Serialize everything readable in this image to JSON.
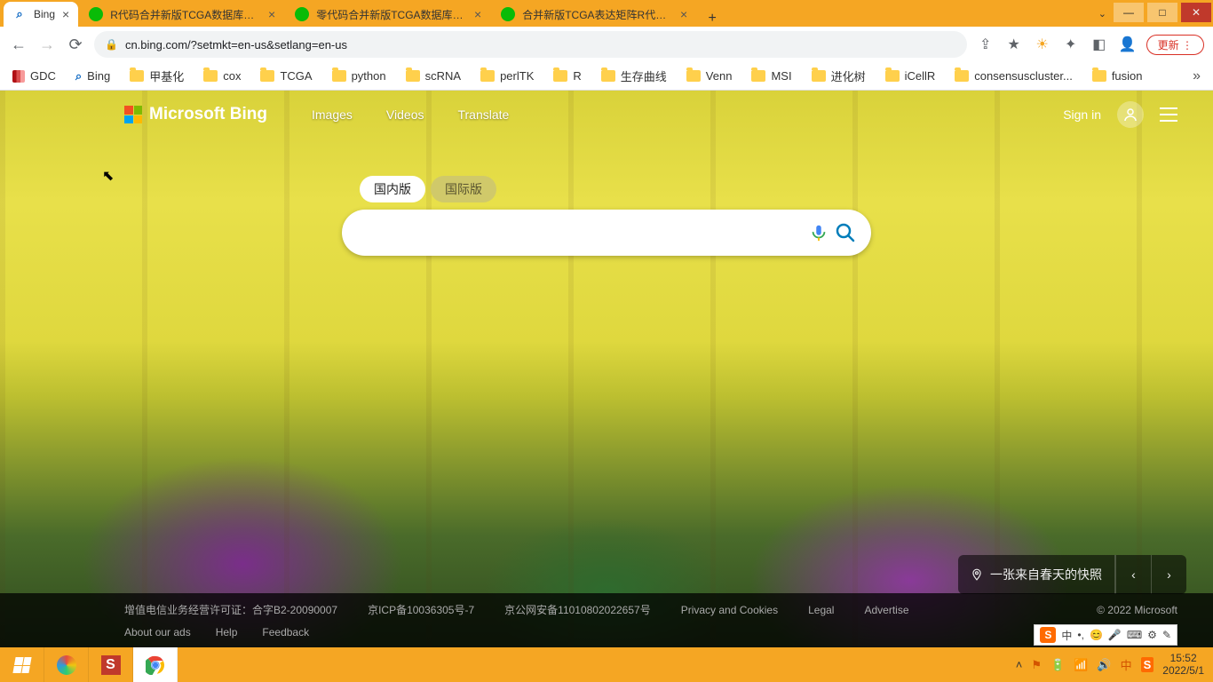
{
  "window": {
    "tabs": [
      {
        "title": "Bing",
        "favicon": "bing"
      },
      {
        "title": "R代码合并新版TCGA数据库RNA",
        "favicon": "wechat"
      },
      {
        "title": "零代码合并新版TCGA数据库RNA",
        "favicon": "wechat"
      },
      {
        "title": "合并新版TCGA表达矩阵R代码系",
        "favicon": "wechat"
      }
    ]
  },
  "toolbar": {
    "url": "cn.bing.com/?setmkt=en-us&setlang=en-us",
    "update_label": "更新"
  },
  "bookmarks": [
    {
      "label": "GDC",
      "icon": "gdc"
    },
    {
      "label": "Bing",
      "icon": "bing"
    },
    {
      "label": "甲基化",
      "icon": "folder"
    },
    {
      "label": "cox",
      "icon": "folder"
    },
    {
      "label": "TCGA",
      "icon": "folder"
    },
    {
      "label": "python",
      "icon": "folder"
    },
    {
      "label": "scRNA",
      "icon": "folder"
    },
    {
      "label": "perlTK",
      "icon": "folder"
    },
    {
      "label": "R",
      "icon": "folder"
    },
    {
      "label": "生存曲线",
      "icon": "folder"
    },
    {
      "label": "Venn",
      "icon": "folder"
    },
    {
      "label": "MSI",
      "icon": "folder"
    },
    {
      "label": "进化树",
      "icon": "folder"
    },
    {
      "label": "iCellR",
      "icon": "folder"
    },
    {
      "label": "consensuscluster...",
      "icon": "folder"
    },
    {
      "label": "fusion",
      "icon": "folder"
    }
  ],
  "bing": {
    "logo_text": "Microsoft Bing",
    "nav": {
      "images": "Images",
      "videos": "Videos",
      "translate": "Translate"
    },
    "signin": "Sign in",
    "pills": {
      "domestic": "国内版",
      "international": "国际版"
    },
    "search_value": "",
    "carousel_caption": "一张来自春天的快照"
  },
  "footer": {
    "line1": {
      "a": "增值电信业务经营许可证：合字B2-20090007",
      "b": "京ICP备10036305号-7",
      "c": "京公网安备11010802022657号",
      "d": "Privacy and Cookies",
      "e": "Legal",
      "f": "Advertise",
      "copyright": "© 2022 Microsoft"
    },
    "line2": {
      "a": "About our ads",
      "b": "Help",
      "c": "Feedback"
    }
  },
  "ime": {
    "lang": "中",
    "punct": "•,",
    "emoji": "😊"
  },
  "taskbar": {
    "time": "15:52",
    "date": "2022/5/1"
  }
}
